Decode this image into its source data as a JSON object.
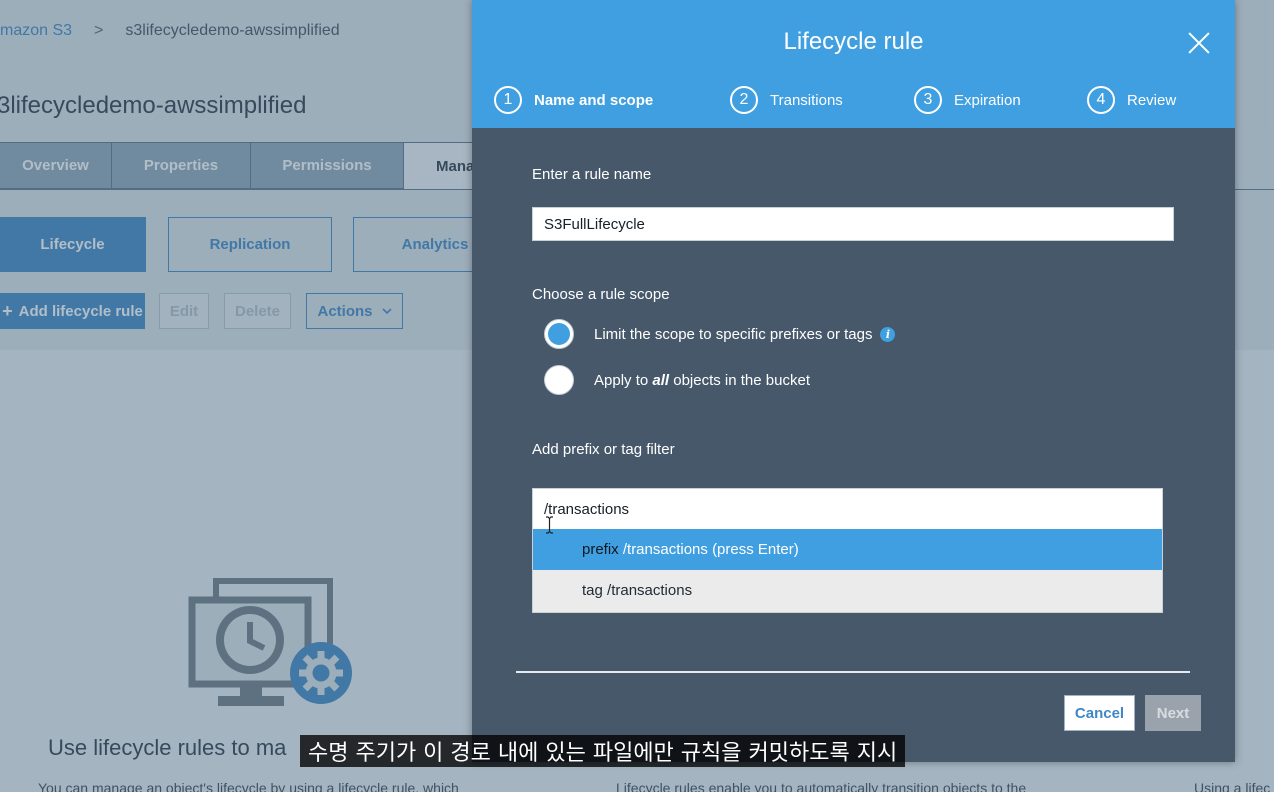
{
  "background": {
    "breadcrumb": {
      "root": "mazon S3",
      "separator": ">",
      "current": "s3lifecycledemo-awssimplified"
    },
    "bucket_title": "3lifecycledemo-awssimplified",
    "tabs": [
      "Overview",
      "Properties",
      "Permissions",
      "Mana"
    ],
    "subtabs": [
      "Lifecycle",
      "Replication",
      "Analytics"
    ],
    "actions": {
      "add_rule": "Add lifecycle rule",
      "edit": "Edit",
      "delete": "Delete",
      "actions": "Actions"
    },
    "empty_heading": "Use lifecycle rules to ma",
    "desc_1": "You can manage an object's lifecycle by using a lifecycle rule, which",
    "desc_2": "Lifecycle rules enable you to automatically transition objects to the",
    "desc_3": "Using a lifec"
  },
  "modal": {
    "title": "Lifecycle rule",
    "steps": [
      {
        "num": "1",
        "label": "Name and scope",
        "active": true
      },
      {
        "num": "2",
        "label": "Transitions"
      },
      {
        "num": "3",
        "label": "Expiration"
      },
      {
        "num": "4",
        "label": "Review"
      }
    ],
    "rule_name_label": "Enter a rule name",
    "rule_name_value": "S3FullLifecycle",
    "scope_label": "Choose a rule scope",
    "scope_option_1": "Limit the scope to specific prefixes or tags",
    "scope_option_2_pre": "Apply to ",
    "scope_option_2_em": "all",
    "scope_option_2_post": " objects in the bucket",
    "filter_label": "Add prefix or tag filter",
    "filter_value": "/transactions",
    "suggestions": {
      "prefix_kw": "prefix",
      "prefix_text": " /transactions (press Enter)",
      "tag_kw": "tag",
      "tag_text": " /transactions"
    },
    "cancel_label": "Cancel",
    "next_label": "Next"
  },
  "caption": "수명 주기가 이 경로 내에 있는 파일에만 규칙을 커밋하도록 지시",
  "colors": {
    "header_blue": "#3f9fe0",
    "modal_body": "#46586a",
    "link_blue": "#3f87c5"
  }
}
